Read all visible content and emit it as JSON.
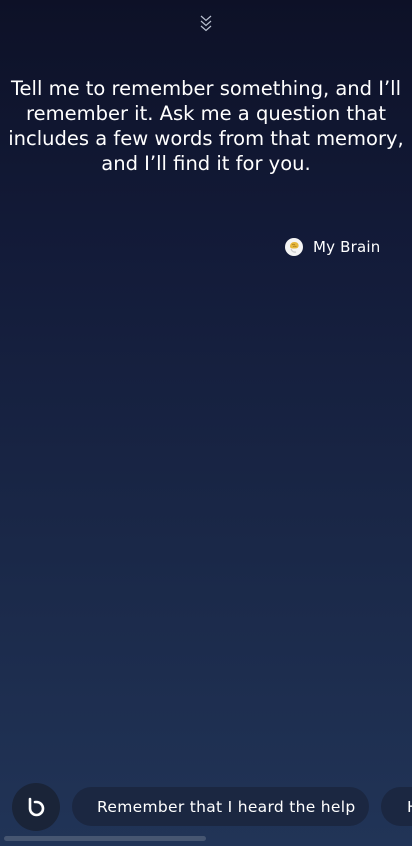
{
  "header": {
    "collapse_icon": "double-chevron-down-icon"
  },
  "conversation": {
    "message": "Tell me to remember something, and I’ll remember it. Ask me a question that includes a few words from that memory, and I’ll find it for you.",
    "brain_link": {
      "icon": "brain-icon",
      "label": "My Brain"
    }
  },
  "bottom_bar": {
    "assistant_icon": "bixby-icon",
    "suggestions": [
      {
        "label": "Remember that I heard the help"
      },
      {
        "label": "H"
      }
    ]
  },
  "colors": {
    "background_top": "#0d1127",
    "background_bottom": "#213457",
    "chip_background": "#1b2741",
    "text": "#ffffff"
  }
}
